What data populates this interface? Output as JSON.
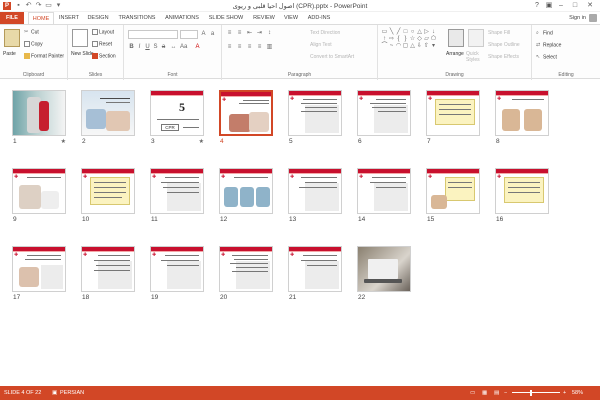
{
  "window": {
    "title": "اصول احیا قلبی و ریوی (CPR).pptx - PowerPoint",
    "app_letter": "P"
  },
  "tabs": [
    "FILE",
    "HOME",
    "INSERT",
    "DESIGN",
    "TRANSITIONS",
    "ANIMATIONS",
    "SLIDE SHOW",
    "REVIEW",
    "VIEW",
    "ADD-INS"
  ],
  "active_tab": "HOME",
  "account": {
    "signin": "Sign in"
  },
  "ribbon": {
    "clipboard": {
      "label": "Clipboard",
      "paste": "Paste",
      "cut": "Cut",
      "copy": "Copy",
      "format_painter": "Format Painter"
    },
    "slides": {
      "label": "Slides",
      "new_slide": "New Slide",
      "layout": "Layout",
      "reset": "Reset",
      "section": "Section"
    },
    "font": {
      "label": "Font"
    },
    "paragraph": {
      "label": "Paragraph",
      "text_direction": "Text Direction",
      "align_text": "Align Text",
      "convert": "Convert to SmartArt"
    },
    "drawing": {
      "label": "Drawing",
      "arrange": "Arrange",
      "quick_styles": "Quick Styles",
      "shape_fill": "Shape Fill",
      "shape_outline": "Shape Outline",
      "shape_effects": "Shape Effects"
    },
    "editing": {
      "label": "Editing",
      "find": "Find",
      "replace": "Replace",
      "select": "Select"
    }
  },
  "slides": [
    {
      "n": "1",
      "star": "★"
    },
    {
      "n": "2"
    },
    {
      "n": "3",
      "star": "★"
    },
    {
      "n": "4"
    },
    {
      "n": "5"
    },
    {
      "n": "6"
    },
    {
      "n": "7"
    },
    {
      "n": "8"
    },
    {
      "n": "9"
    },
    {
      "n": "10"
    },
    {
      "n": "11"
    },
    {
      "n": "12"
    },
    {
      "n": "13"
    },
    {
      "n": "14"
    },
    {
      "n": "15"
    },
    {
      "n": "16"
    },
    {
      "n": "17"
    },
    {
      "n": "18"
    },
    {
      "n": "19"
    },
    {
      "n": "20"
    },
    {
      "n": "21"
    },
    {
      "n": "22"
    }
  ],
  "selected_slide": "4",
  "slide3": {
    "big_number": "5",
    "badge": "CPR"
  },
  "status": {
    "slide_info": "SLIDE 4 OF 22",
    "language": "PERSIAN",
    "zoom": "58%"
  },
  "colors": {
    "accent": "#d24726",
    "slide_red": "#c8102e"
  }
}
